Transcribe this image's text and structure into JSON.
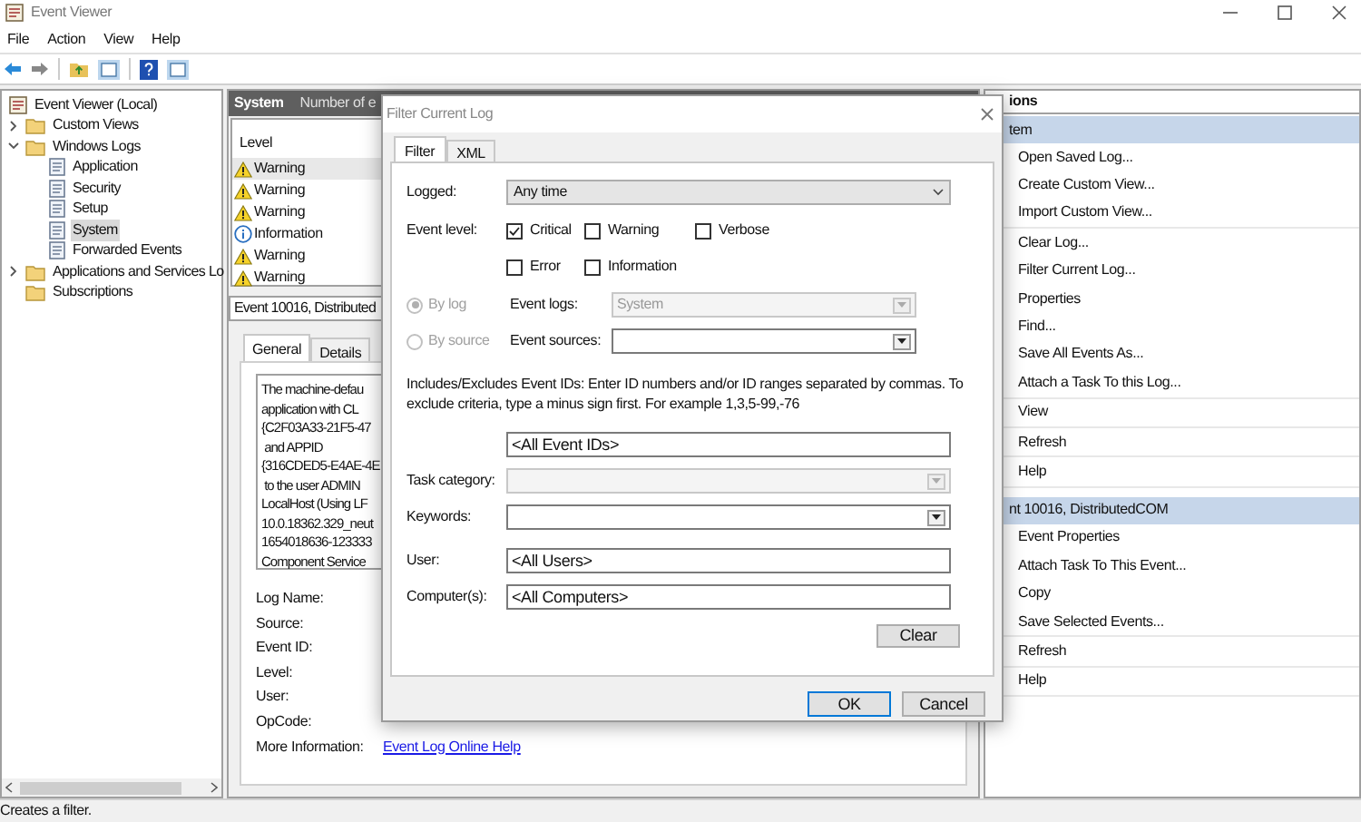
{
  "window": {
    "title": "Event Viewer"
  },
  "menu": [
    "File",
    "Action",
    "View",
    "Help"
  ],
  "tree": [
    {
      "label": "Event Viewer (Local)",
      "kind": "viewer",
      "selected": false,
      "children": [
        {
          "label": "Custom Views",
          "kind": "folder",
          "expanded": false,
          "selected": false
        },
        {
          "label": "Windows Logs",
          "kind": "folder",
          "expanded": true,
          "selected": false,
          "children": [
            {
              "label": "Application",
              "kind": "log",
              "selected": false
            },
            {
              "label": "Security",
              "kind": "log",
              "selected": false
            },
            {
              "label": "Setup",
              "kind": "log",
              "selected": false
            },
            {
              "label": "System",
              "kind": "log",
              "selected": true
            },
            {
              "label": "Forwarded Events",
              "kind": "log",
              "selected": false
            }
          ]
        },
        {
          "label": "Applications and Services Lo",
          "kind": "folder",
          "expanded": false,
          "selected": false
        },
        {
          "label": "Subscriptions",
          "kind": "folder",
          "selected": false
        }
      ]
    }
  ],
  "log": {
    "title": "System",
    "subtitle": "Number of e",
    "column": "Level",
    "events": [
      {
        "kind": "warning",
        "label": "Warning",
        "selected": true
      },
      {
        "kind": "warning",
        "label": "Warning",
        "selected": false
      },
      {
        "kind": "warning",
        "label": "Warning",
        "selected": false
      },
      {
        "kind": "information",
        "label": "Information",
        "selected": false
      },
      {
        "kind": "warning",
        "label": "Warning",
        "selected": false
      },
      {
        "kind": "warning",
        "label": "Warning",
        "selected": false
      }
    ],
    "detail": {
      "title": "Event 10016, Distributed",
      "tabs": [
        {
          "label": "General",
          "selected": true
        },
        {
          "label": "Details",
          "selected": false
        }
      ],
      "message": [
        "The machine-defau",
        "application with CL",
        "{C2F03A33-21F5-47",
        " and APPID",
        "{316CDED5-E4AE-4E",
        " to the user ADMIN",
        "LocalHost (Using LF",
        "10.0.18362.329_neut",
        "1654018636-123333",
        "Component Service"
      ],
      "fields": [
        "Log Name:",
        "Source:",
        "Event ID:",
        "Level:",
        "User:",
        "OpCode:",
        "More Information:"
      ],
      "link": "Event Log Online Help"
    }
  },
  "dialog": {
    "title": "Filter Current Log",
    "tabs": [
      {
        "label": "Filter",
        "selected": true
      },
      {
        "label": "XML",
        "selected": false
      }
    ],
    "logged": {
      "label": "Logged:",
      "value": "Any time"
    },
    "event_level": {
      "label": "Event level:",
      "options": [
        {
          "label": "Critical",
          "checked": true
        },
        {
          "label": "Warning",
          "checked": false
        },
        {
          "label": "Verbose",
          "checked": false
        },
        {
          "label": "Error",
          "checked": false
        },
        {
          "label": "Information",
          "checked": false
        }
      ]
    },
    "scope": [
      {
        "label": "By log",
        "selected": true,
        "disabled": true,
        "field_label": "Event logs:",
        "value": "System",
        "field_disabled": true
      },
      {
        "label": "By source",
        "selected": false,
        "disabled": true,
        "field_label": "Event sources:",
        "field_disabled": false
      }
    ],
    "description": "Includes/Excludes Event IDs: Enter ID numbers and/or ID ranges separated by commas. To exclude criteria, type a minus sign first. For example 1,3,5-99,-76",
    "event_ids": "<All Event IDs>",
    "fields": [
      {
        "label": "Task category:",
        "kind": "dropdown",
        "disabled": true
      },
      {
        "label": "Keywords:",
        "kind": "dropdown",
        "disabled": false
      },
      {
        "label": "User:",
        "kind": "text",
        "value": "<All Users>"
      },
      {
        "label": "Computer(s):",
        "kind": "text",
        "value": "<All Computers>"
      }
    ],
    "clear_button": "Clear",
    "buttons": [
      {
        "label": "OK",
        "default": true
      },
      {
        "label": "Cancel",
        "default": false
      }
    ]
  },
  "actions": {
    "title": "ions",
    "sections": [
      {
        "title": "tem",
        "groups": [
          [
            "Open Saved Log...",
            "Create Custom View...",
            "Import Custom View..."
          ],
          [
            "Clear Log...",
            "Filter Current Log...",
            "Properties",
            "Find...",
            "Save All Events As...",
            "Attach a Task To this Log..."
          ],
          [
            "View"
          ],
          [
            "Refresh"
          ],
          [
            "Help"
          ]
        ]
      },
      {
        "title": "nt 10016, DistributedCOM",
        "groups": [
          [
            "Event Properties",
            "Attach Task To This Event...",
            "Copy",
            "Save Selected Events..."
          ],
          [
            "Refresh"
          ],
          [
            "Help"
          ]
        ]
      }
    ]
  },
  "status": "Creates a filter."
}
